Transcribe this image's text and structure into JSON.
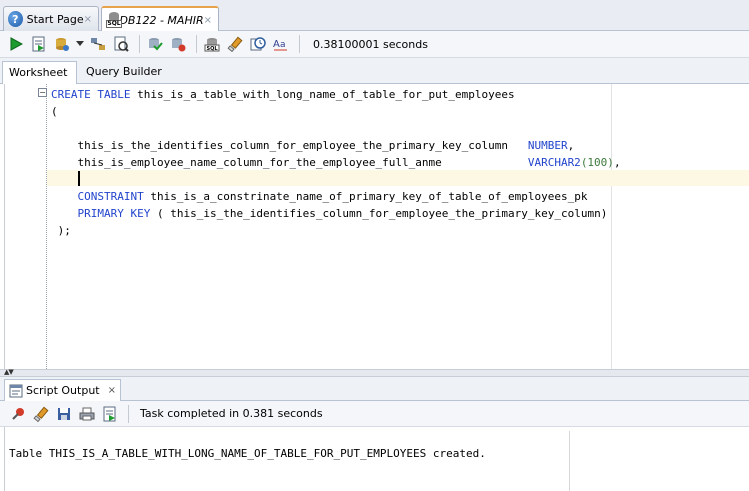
{
  "doc_tabs": [
    {
      "label": "Start Page",
      "close": "×",
      "icon": "help-icon"
    },
    {
      "label": "DB122 - MAHIR",
      "close": "×",
      "icon": "sql-database-icon"
    }
  ],
  "toolbar": {
    "timing": "0.38100001 seconds",
    "icons": [
      "run-statement-icon",
      "run-script-icon",
      "commit-icon",
      "dropdown-icon",
      "explain-plan-icon",
      "autotrace-icon",
      "sql-tuning-icon",
      "commit-transaction-icon",
      "rollback-icon",
      "unshared-sql-icon",
      "clear-icon",
      "history-icon",
      "format-case-icon"
    ]
  },
  "worksheet_tabs": {
    "worksheet": "Worksheet",
    "query_builder": "Query Builder"
  },
  "editor": {
    "lines": [
      {
        "kw": "CREATE TABLE",
        "text": " this_is_a_table_with_long_name_of_table_for_put_employees"
      },
      {
        "text": "("
      },
      {
        "text": ""
      },
      {
        "text": "    this_is_the_identifies_column_for_employee_the_primary_key_column   ",
        "kw2": "NUMBER",
        "tail": ","
      },
      {
        "text": "    this_is_employee_name_column_for_the_employee_full_anme             ",
        "kw2": "VARCHAR2",
        "num": "(100)",
        "tail": ","
      },
      {
        "text": ""
      },
      {
        "pre": "    ",
        "kw": "CONSTRAINT",
        "text": " this_is_a_constrinate_name_of_primary_key_of_table_of_employees_pk"
      },
      {
        "pre": "    ",
        "kw": "PRIMARY KEY",
        "text": " ( this_is_the_identifies_column_for_employee_the_primary_key_column)"
      },
      {
        "text": " );"
      }
    ],
    "fold_symbol": "−"
  },
  "output": {
    "tab_label": "Script Output",
    "tab_close": "×",
    "status": "Task completed in 0.381 seconds",
    "text": "Table THIS_IS_A_TABLE_WITH_LONG_NAME_OF_TABLE_FOR_PUT_EMPLOYEES created.",
    "icons": [
      "pin-icon",
      "clear-output-icon",
      "save-icon",
      "print-icon",
      "run-script-icon"
    ]
  },
  "colors": {
    "keyword": "#2244cc",
    "number": "#3b7a3b",
    "current_line": "#fdf8e4",
    "active_tab_accent": "#e8a34a"
  }
}
